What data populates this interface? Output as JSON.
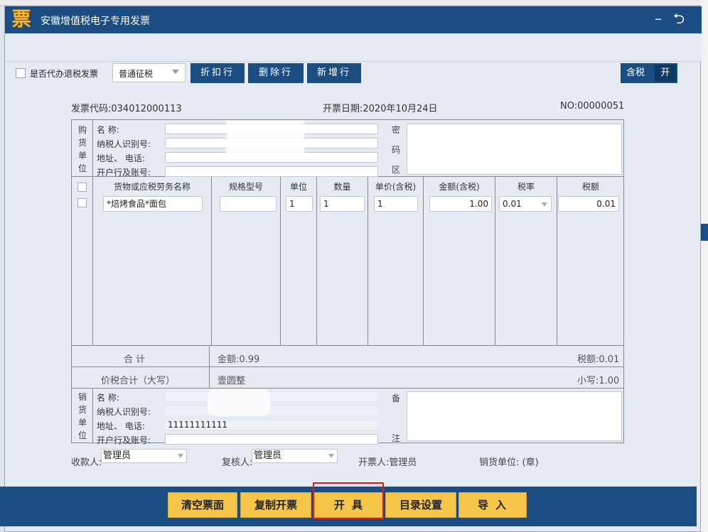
{
  "window": {
    "logo_glyph": "票",
    "title": "安徽增值税电子专用发票",
    "minimize_glyph": "–",
    "restore_glyph": "⮌"
  },
  "toolbar": {
    "agent_refund_label": "是否代办退税发票",
    "tax_type": "普通征税",
    "discount_line": "折扣行",
    "delete_line": "删除行",
    "add_line": "新增行",
    "tax_included_label": "含税",
    "tax_included_state": "开"
  },
  "header": {
    "invoice_code": "发票代码:034012000113",
    "issue_date": "开票日期:2020年10月24日",
    "invoice_no": "NO:00000051"
  },
  "buyer": {
    "section_chars": [
      "购",
      "货",
      "单",
      "位"
    ],
    "name_label": "名        称:",
    "taxid_label": "纳税人识别号:",
    "address_label": "地址、 电话:",
    "bank_label": "开户行及账号:",
    "cipher_chars": [
      "密",
      "码",
      "区"
    ]
  },
  "items": {
    "headers": [
      "货物或应税劳务名称",
      "规格型号",
      "单位",
      "数量",
      "单价(含税)",
      "金额(含税)",
      "税率",
      "税额"
    ],
    "rows": [
      {
        "name": "*焙烤食品*面包",
        "spec": "",
        "unit": "1",
        "qty": "1",
        "price": "1",
        "amount": "1.00",
        "rate": "0.01",
        "tax": "0.01"
      }
    ]
  },
  "totals": {
    "total_label": "合        计",
    "amount": "金额:0.99",
    "tax": "税额:0.01",
    "grand_label": "价税合计（大写）",
    "grand_words": "壹圆整",
    "grand_small": "小写:1.00"
  },
  "seller": {
    "section_chars": [
      "销",
      "货",
      "单",
      "位"
    ],
    "name_label": "名        称:",
    "taxid_label": "纳税人识别号:",
    "address_label": "地址、 电话:",
    "address_value": "11111111111",
    "bank_label": "开户行及账号:",
    "remark_chars": [
      "备",
      "注"
    ]
  },
  "signatures": {
    "payee_label": "收款人:",
    "payee": "管理员",
    "reviewer_label": "复核人:",
    "reviewer": "管理员",
    "drawer": "开票人:管理员",
    "seller_seal": "销货单位:  (章)"
  },
  "actions": {
    "clear": "清空票面",
    "copy": "复制开票",
    "issue": "开具",
    "catalog": "目录设置",
    "import": "导入"
  },
  "colors": {
    "primary": "#1b4d82",
    "action_button": "#f6c64a",
    "highlight": "#e0191d"
  }
}
